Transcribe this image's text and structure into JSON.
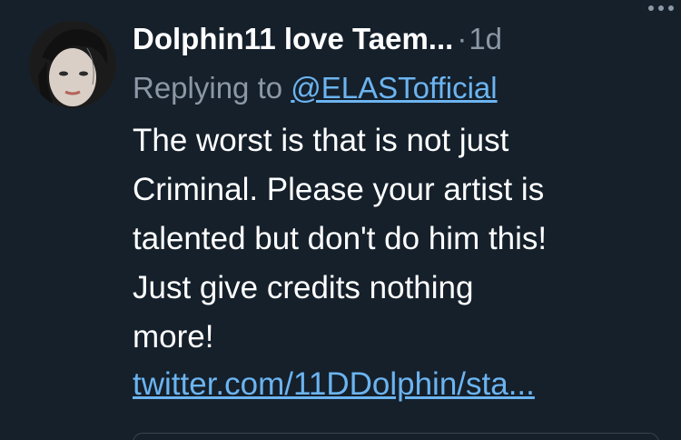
{
  "tweet": {
    "display_name": "Dolphin11 love Taem...",
    "separator": "·",
    "time": "1d",
    "reply_prefix": "Replying to",
    "reply_handle": "@ELASTofficial",
    "body_lines": [
      "The worst is that is not just",
      "Criminal. Please your artist is",
      "talented but don't do him this!",
      "Just give credits nothing",
      "more!"
    ],
    "link": "twitter.com/11DDolphin/sta..."
  },
  "colors": {
    "background": "#15202b",
    "text": "#ffffff",
    "secondary": "#8b98a5",
    "link": "#6cb4f0"
  },
  "icons": {
    "more": "more-horizontal-icon",
    "avatar": "user-avatar"
  }
}
